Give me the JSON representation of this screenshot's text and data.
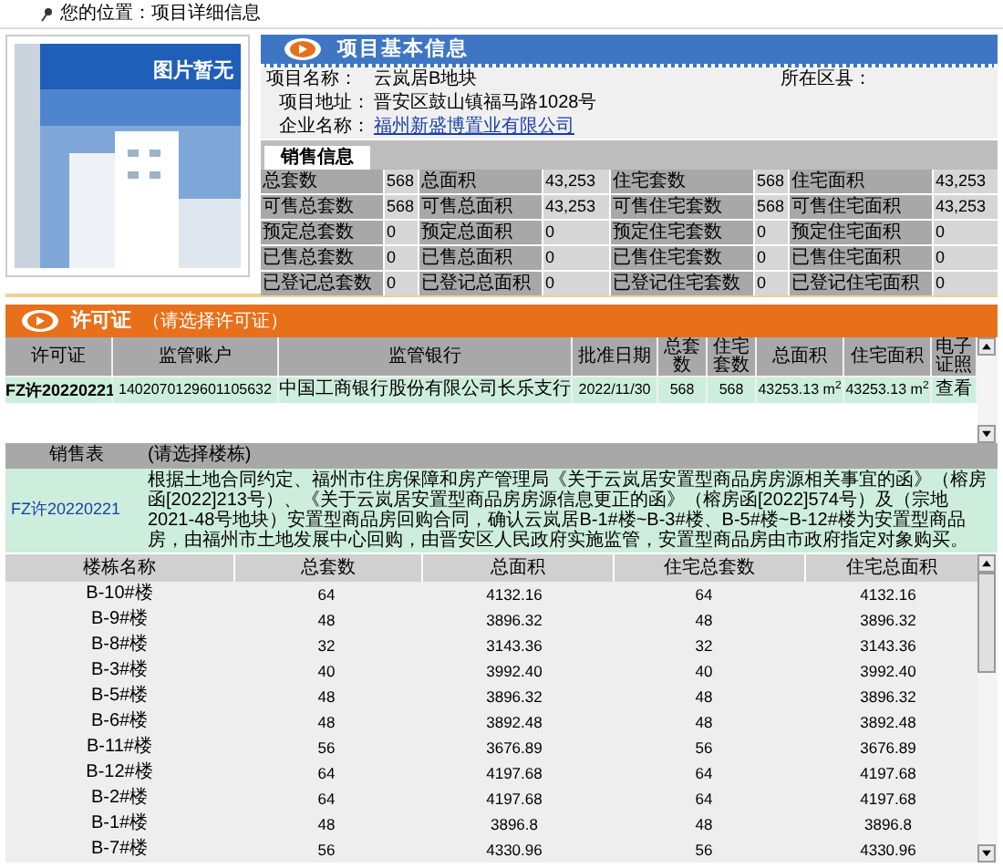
{
  "breadcrumb": {
    "label": "您的位置：项目详细信息"
  },
  "project": {
    "title": "项目基本信息",
    "image_label": "图片暂无",
    "district_label": "所在区县：",
    "fields": [
      {
        "label": "项目名称：",
        "value": "云岚居B地块",
        "kind": "text"
      },
      {
        "label": "项目地址：",
        "value": "晋安区鼓山镇福马路1028号",
        "kind": "text"
      },
      {
        "label": "企业名称：",
        "value": "福州新盛博置业有限公司",
        "kind": "link"
      }
    ]
  },
  "sales_info": {
    "tab": "销售信息",
    "rows": [
      [
        {
          "label": "总套数",
          "value": "568"
        },
        {
          "label": "总面积",
          "value": "43,253"
        },
        {
          "label": "住宅套数",
          "value": "568"
        },
        {
          "label": "住宅面积",
          "value": "43,253"
        }
      ],
      [
        {
          "label": "可售总套数",
          "value": "568"
        },
        {
          "label": "可售总面积",
          "value": "43,253"
        },
        {
          "label": "可售住宅套数",
          "value": "568"
        },
        {
          "label": "可售住宅面积",
          "value": "43,253"
        }
      ],
      [
        {
          "label": "预定总套数",
          "value": "0"
        },
        {
          "label": "预定总面积",
          "value": "0"
        },
        {
          "label": "预定住宅套数",
          "value": "0"
        },
        {
          "label": "预定住宅面积",
          "value": "0"
        }
      ],
      [
        {
          "label": "已售总套数",
          "value": "0"
        },
        {
          "label": "已售总面积",
          "value": "0"
        },
        {
          "label": "已售住宅套数",
          "value": "0"
        },
        {
          "label": "已售住宅面积",
          "value": "0"
        }
      ],
      [
        {
          "label": "已登记总套数",
          "value": "0"
        },
        {
          "label": "已登记总面积",
          "value": "0"
        },
        {
          "label": "已登记住宅套数",
          "value": "0"
        },
        {
          "label": "已登记住宅面积",
          "value": "0"
        }
      ]
    ]
  },
  "permits": {
    "title": "许可证",
    "hint": "（请选择许可证）",
    "columns": [
      "许可证",
      "监管账户",
      "监管银行",
      "批准日期",
      "总套数",
      "住宅套数",
      "总面积",
      "住宅面积",
      "电子证照"
    ],
    "rows": [
      {
        "selected": true,
        "cells": [
          "FZ许20220221",
          "1402070129601105632",
          "中国工商银行股份有限公司长乐支行",
          "2022/11/30",
          "568",
          "568",
          "43253.13 m$^{2}$",
          "43253.13 m$^{2}$",
          "查看"
        ]
      }
    ]
  },
  "sales_table": {
    "title": "销售表",
    "hint": "(请选择楼栋)",
    "permit_link": "FZ许20220221",
    "description": "根据土地合同约定、福州市住房保障和房产管理局《关于云岚居安置型商品房房源相关事宜的函》（榕房函[2022]213号）、《关于云岚居安置型商品房房源信息更正的函》（榕房函[2022]574号）及（宗地2021-48号地块）安置型商品房回购合同，确认云岚居B-1#楼~B-3#楼、B-5#楼~B-12#楼为安置型商品房，由福州市土地发展中心回购，由晋安区人民政府实施监管，安置型商品房由市政府指定对象购买。",
    "columns": [
      "楼栋名称",
      "总套数",
      "总面积",
      "住宅总套数",
      "住宅总面积"
    ],
    "rows": [
      [
        "B-10#楼",
        "64",
        "4132.16",
        "64",
        "4132.16"
      ],
      [
        "B-9#楼",
        "48",
        "3896.32",
        "48",
        "3896.32"
      ],
      [
        "B-8#楼",
        "32",
        "3143.36",
        "32",
        "3143.36"
      ],
      [
        "B-3#楼",
        "40",
        "3992.40",
        "40",
        "3992.40"
      ],
      [
        "B-5#楼",
        "48",
        "3896.32",
        "48",
        "3896.32"
      ],
      [
        "B-6#楼",
        "48",
        "3892.48",
        "48",
        "3892.48"
      ],
      [
        "B-11#楼",
        "56",
        "3676.89",
        "56",
        "3676.89"
      ],
      [
        "B-12#楼",
        "64",
        "4197.68",
        "64",
        "4197.68"
      ],
      [
        "B-2#楼",
        "64",
        "4197.68",
        "64",
        "4197.68"
      ],
      [
        "B-1#楼",
        "48",
        "3896.8",
        "48",
        "3896.8"
      ],
      [
        "B-7#楼",
        "56",
        "4330.96",
        "56",
        "4330.96"
      ]
    ]
  }
}
